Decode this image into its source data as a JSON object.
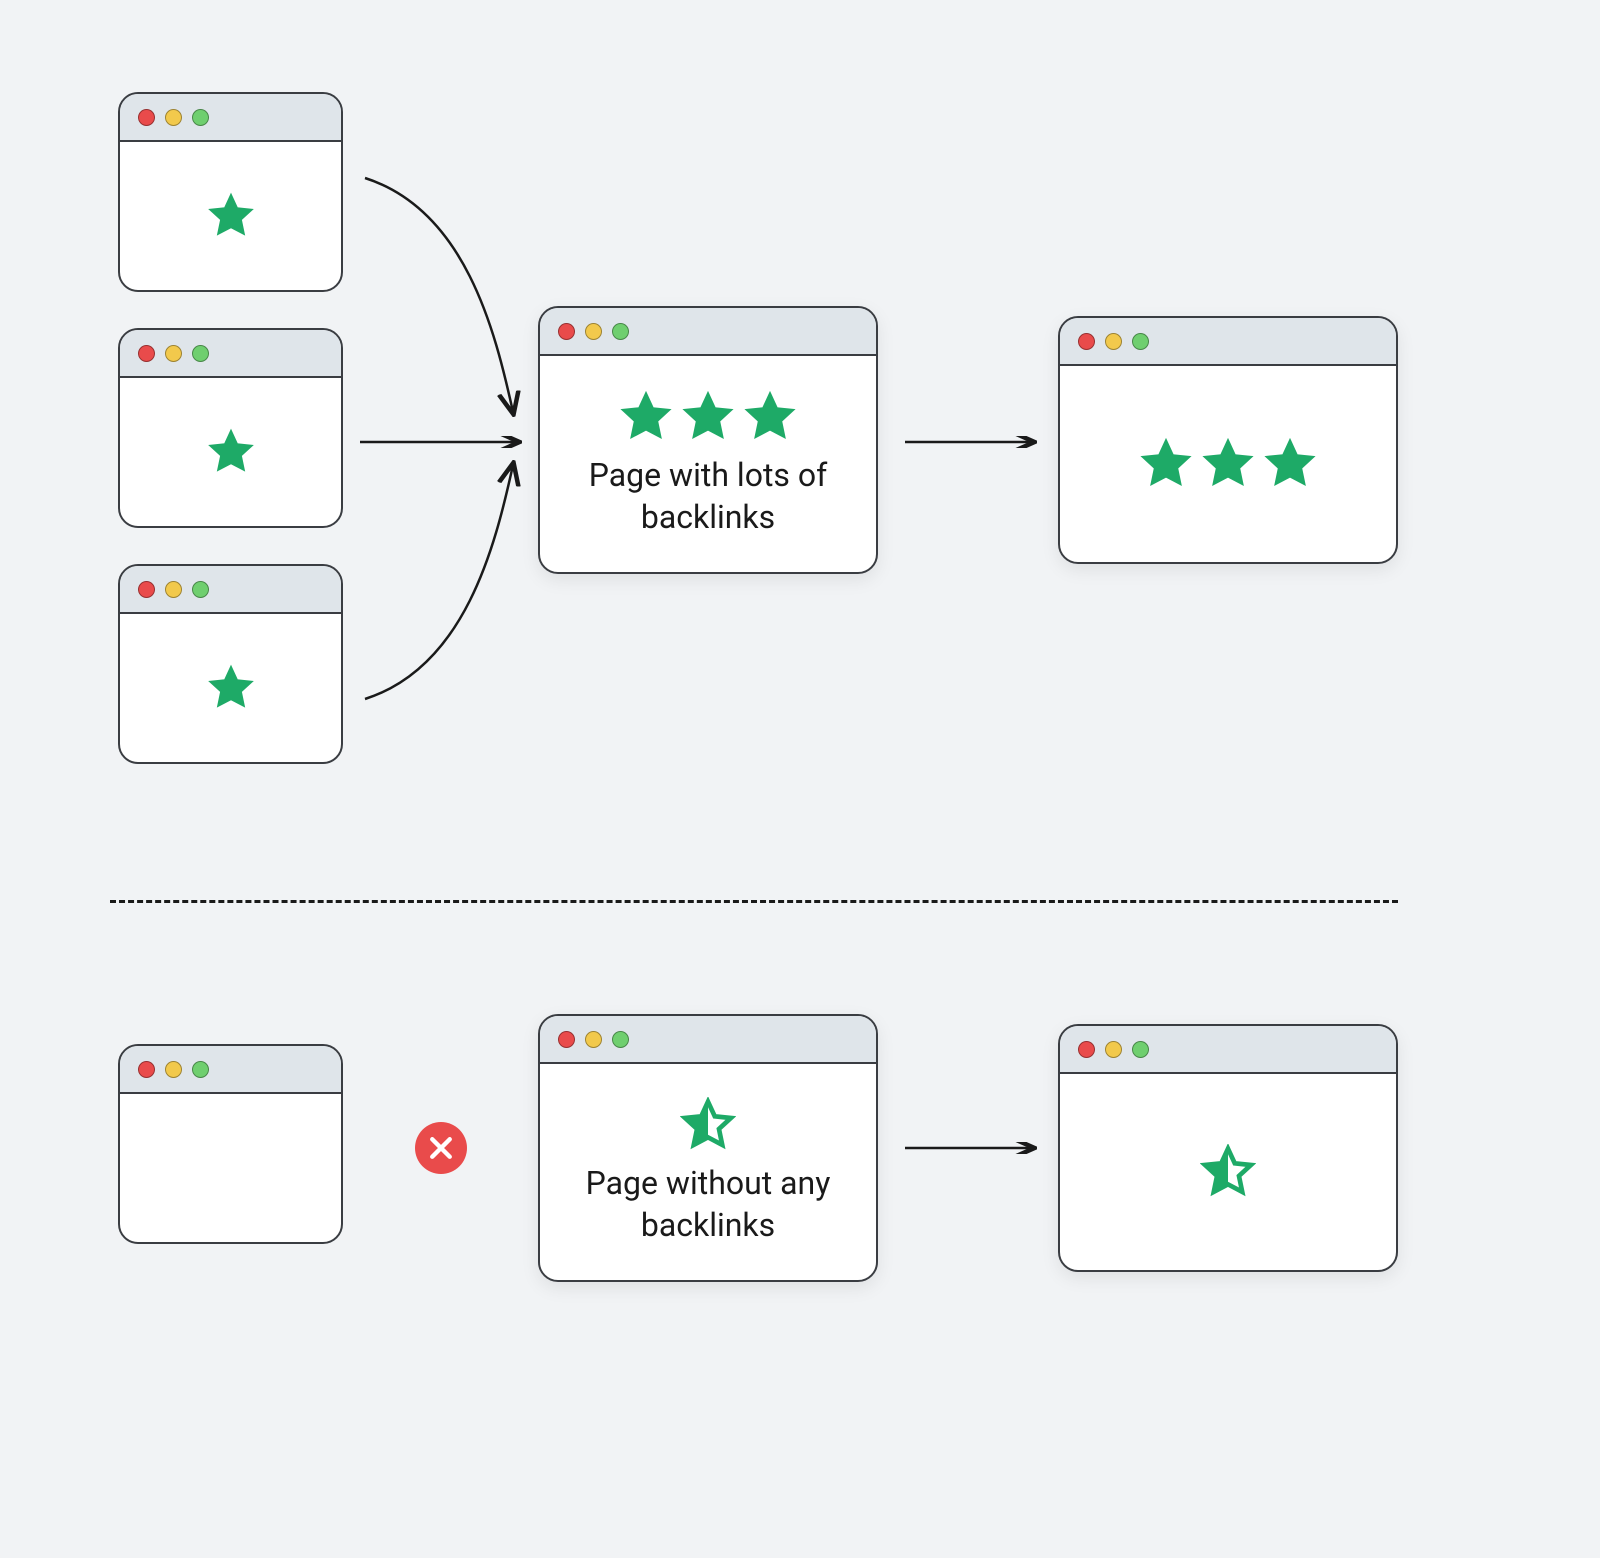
{
  "colors": {
    "star_fill": "#1eaa67",
    "star_stroke": "#1eaa67",
    "x_bg": "#e94b4b",
    "border": "#3a3d42",
    "header_bg": "#dfe5ea"
  },
  "top_section": {
    "source_pages": [
      {
        "stars": 1
      },
      {
        "stars": 1
      },
      {
        "stars": 1
      }
    ],
    "center_page": {
      "stars": 3,
      "label": "Page with lots of backlinks"
    },
    "result_page": {
      "stars": 3
    }
  },
  "bottom_section": {
    "source_page": {
      "stars": 0
    },
    "center_page": {
      "half_star": true,
      "label": "Page without any backlinks"
    },
    "result_page": {
      "half_star": true
    }
  }
}
